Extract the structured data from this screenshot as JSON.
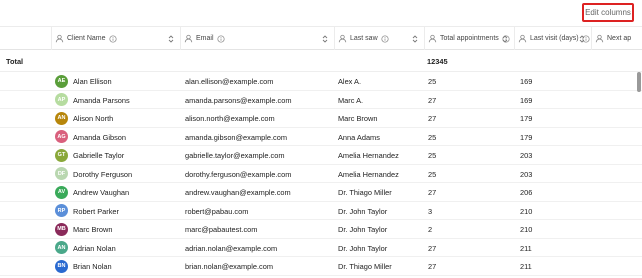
{
  "toolbar": {
    "edit_columns_label": "Edit columns"
  },
  "columns": [
    {
      "label": "Client Name",
      "icon": "person-icon",
      "info": true
    },
    {
      "label": "Email",
      "icon": "person-icon",
      "info": true
    },
    {
      "label": "Last saw",
      "icon": "person-icon",
      "info": true
    },
    {
      "label": "Total appointments",
      "icon": "person-icon",
      "info": true
    },
    {
      "label": "Last visit (days)",
      "icon": "person-icon",
      "info": true
    },
    {
      "label": "Next ap",
      "icon": "person-icon",
      "info": false
    }
  ],
  "total": {
    "label": "Total",
    "appointments": "12345"
  },
  "rows": [
    {
      "initials": "AE",
      "color": "#5a9e3a",
      "name": "Alan Ellison",
      "email": "alan.ellison@example.com",
      "last_saw": "Alex A.",
      "appointments": "25",
      "last_visit": "169"
    },
    {
      "initials": "AP",
      "color": "#b6dca0",
      "name": "Amanda Parsons",
      "email": "amanda.parsons@example.com",
      "last_saw": "Marc A.",
      "appointments": "27",
      "last_visit": "169"
    },
    {
      "initials": "AN",
      "color": "#b7860b",
      "name": "Alison North",
      "email": "alison.north@example.com",
      "last_saw": "Marc Brown",
      "appointments": "27",
      "last_visit": "179"
    },
    {
      "initials": "AG",
      "color": "#d9607d",
      "name": "Amanda Gibson",
      "email": "amanda.gibson@example.com",
      "last_saw": "Anna Adams",
      "appointments": "25",
      "last_visit": "179"
    },
    {
      "initials": "GT",
      "color": "#8aa83a",
      "name": "Gabrielle Taylor",
      "email": "gabrielle.taylor@example.com",
      "last_saw": "Amelia Hernandez",
      "appointments": "25",
      "last_visit": "203"
    },
    {
      "initials": "DF",
      "color": "#b9d7b0",
      "name": "Dorothy Ferguson",
      "email": "dorothy.ferguson@example.com",
      "last_saw": "Amelia Hernandez",
      "appointments": "25",
      "last_visit": "203"
    },
    {
      "initials": "AV",
      "color": "#3aaa5a",
      "name": "Andrew Vaughan",
      "email": "andrew.vaughan@example.com",
      "last_saw": "Dr. Thiago Miller",
      "appointments": "27",
      "last_visit": "206"
    },
    {
      "initials": "RP",
      "color": "#5b8fd9",
      "name": "Robert Parker",
      "email": "robert@pabau.com",
      "last_saw": "Dr. John Taylor",
      "appointments": "3",
      "last_visit": "210"
    },
    {
      "initials": "MB",
      "color": "#8a2a5a",
      "name": "Marc Brown",
      "email": "marc@pabautest.com",
      "last_saw": "Dr. John Taylor",
      "appointments": "2",
      "last_visit": "210"
    },
    {
      "initials": "AN",
      "color": "#4aa88a",
      "name": "Adrian Nolan",
      "email": "adrian.nolan@example.com",
      "last_saw": "Dr. John Taylor",
      "appointments": "27",
      "last_visit": "211"
    },
    {
      "initials": "BN",
      "color": "#2a6ad0",
      "name": "Brian Nolan",
      "email": "brian.nolan@example.com",
      "last_saw": "Dr. Thiago Miller",
      "appointments": "27",
      "last_visit": "211"
    }
  ]
}
